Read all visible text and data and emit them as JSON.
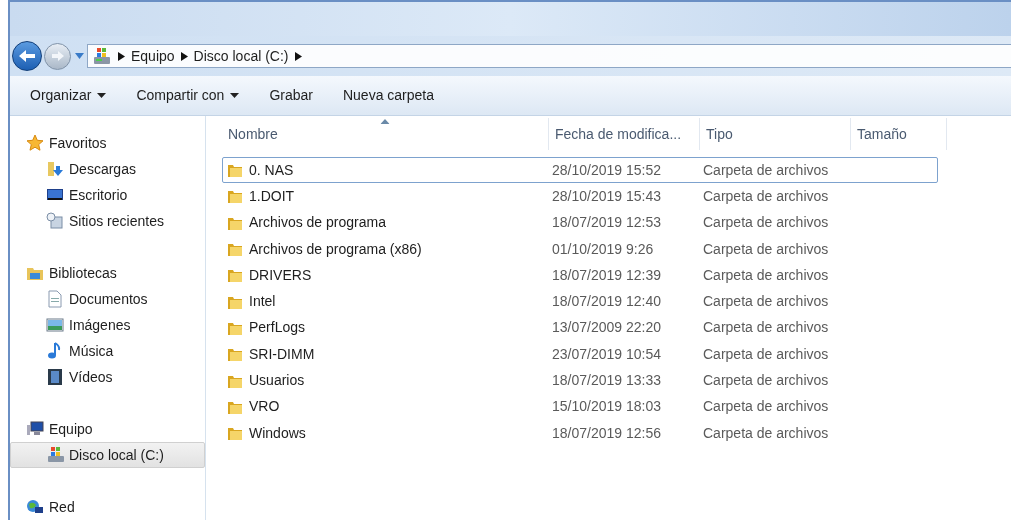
{
  "address_bar": {
    "crumbs": [
      "Equipo",
      "Disco local (C:)"
    ]
  },
  "toolbar": [
    {
      "label": "Organizar",
      "dropdown": true
    },
    {
      "label": "Compartir con",
      "dropdown": true
    },
    {
      "label": "Grabar",
      "dropdown": false
    },
    {
      "label": "Nueva carpeta",
      "dropdown": false
    }
  ],
  "sidebar": {
    "groups": [
      {
        "label": "Favoritos",
        "kind": "star",
        "children": [
          {
            "label": "Descargas",
            "kind": "download",
            "selected": false
          },
          {
            "label": "Escritorio",
            "kind": "desktop",
            "selected": false
          },
          {
            "label": "Sitios recientes",
            "kind": "recent",
            "selected": false
          }
        ]
      },
      {
        "label": "Bibliotecas",
        "kind": "library",
        "children": [
          {
            "label": "Documentos",
            "kind": "document",
            "selected": false
          },
          {
            "label": "Imágenes",
            "kind": "images",
            "selected": false
          },
          {
            "label": "Música",
            "kind": "music",
            "selected": false
          },
          {
            "label": "Vídeos",
            "kind": "video",
            "selected": false
          }
        ]
      },
      {
        "label": "Equipo",
        "kind": "computer",
        "children": [
          {
            "label": "Disco local (C:)",
            "kind": "drive",
            "selected": true
          }
        ]
      },
      {
        "label": "Red",
        "kind": "network"
      }
    ]
  },
  "table": {
    "columns": [
      {
        "label": "Nombre",
        "sorted": true
      },
      {
        "label": "Fecha de modifica...",
        "sorted": false
      },
      {
        "label": "Tipo",
        "sorted": false
      },
      {
        "label": "Tamaño",
        "sorted": false
      }
    ],
    "rows": [
      {
        "name": "0. NAS",
        "date": "28/10/2019 15:52",
        "type": "Carpeta de archivos",
        "selected": true
      },
      {
        "name": "1.DOIT",
        "date": "28/10/2019 15:43",
        "type": "Carpeta de archivos",
        "selected": false
      },
      {
        "name": "Archivos de programa",
        "date": "18/07/2019 12:53",
        "type": "Carpeta de archivos",
        "selected": false
      },
      {
        "name": "Archivos de programa (x86)",
        "date": "01/10/2019 9:26",
        "type": "Carpeta de archivos",
        "selected": false
      },
      {
        "name": "DRIVERS",
        "date": "18/07/2019 12:39",
        "type": "Carpeta de archivos",
        "selected": false
      },
      {
        "name": "Intel",
        "date": "18/07/2019 12:40",
        "type": "Carpeta de archivos",
        "selected": false
      },
      {
        "name": "PerfLogs",
        "date": "13/07/2009 22:20",
        "type": "Carpeta de archivos",
        "selected": false
      },
      {
        "name": "SRI-DIMM",
        "date": "23/07/2019 10:54",
        "type": "Carpeta de archivos",
        "selected": false
      },
      {
        "name": "Usuarios",
        "date": "18/07/2019 13:33",
        "type": "Carpeta de archivos",
        "selected": false
      },
      {
        "name": "VRO",
        "date": "15/10/2019 18:03",
        "type": "Carpeta de archivos",
        "selected": false
      },
      {
        "name": "Windows",
        "date": "18/07/2019 12:56",
        "type": "Carpeta de archivos",
        "selected": false
      }
    ]
  }
}
